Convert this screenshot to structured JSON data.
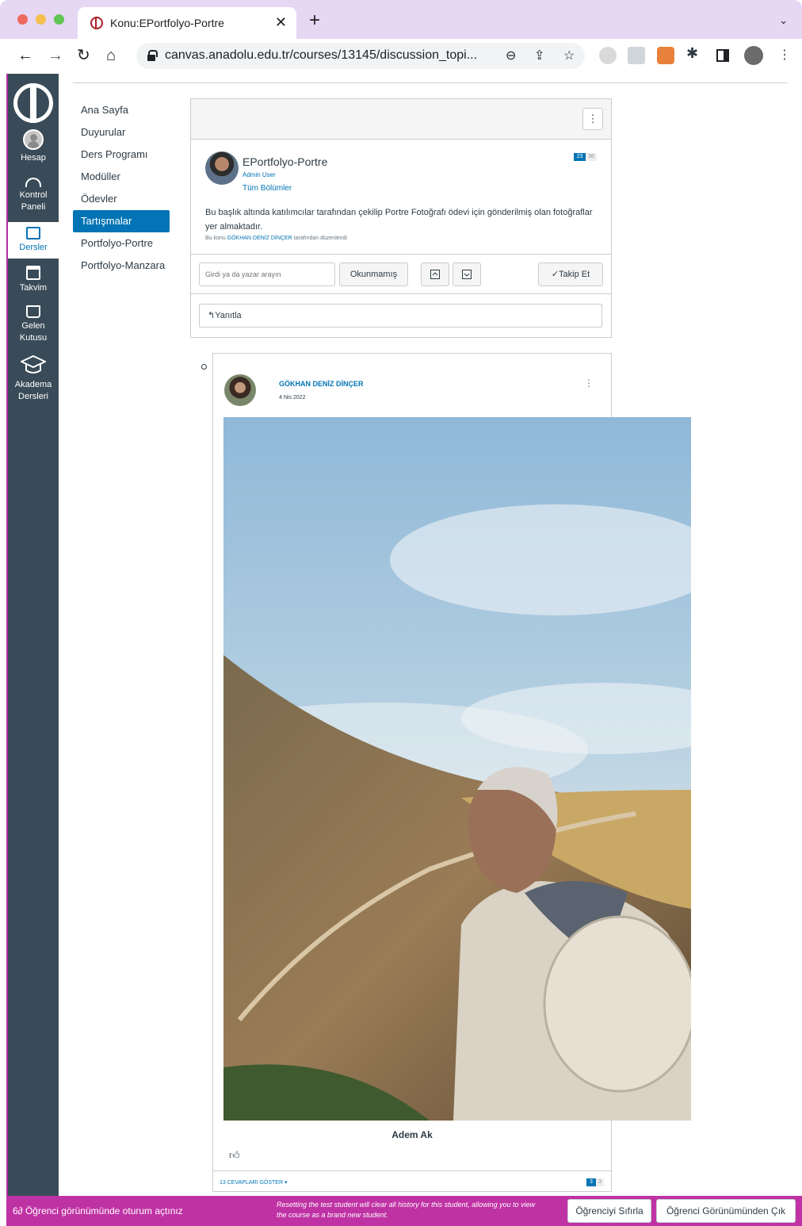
{
  "browser": {
    "tab_title": "Konu:EPortfolyo-Portre",
    "url": "canvas.anadolu.edu.tr/courses/13145/discussion_topi..."
  },
  "global_nav": {
    "items": [
      {
        "label": "Hesap",
        "icon": "account-avatar-icon"
      },
      {
        "label": "Kontrol\nPaneli",
        "icon": "dashboard-icon"
      },
      {
        "label": "Dersler",
        "icon": "courses-icon"
      },
      {
        "label": "Takvim",
        "icon": "calendar-icon"
      },
      {
        "label": "Gelen\nKutusu",
        "icon": "inbox-icon"
      },
      {
        "label": "Akadema\nDersleri",
        "icon": "graduation-cap-icon"
      }
    ]
  },
  "course_nav": {
    "items": [
      "Ana Sayfa",
      "Duyurular",
      "Ders Programı",
      "Modüller",
      "Ödevler",
      "Tartışmalar",
      "Portfolyo-Portre",
      "Portfolyo-Manzara"
    ],
    "active": "Tartışmalar"
  },
  "topic": {
    "title": "EPortfolyo-Portre",
    "role": "Admin User",
    "sections": "Tüm Bölümler",
    "unread_count": "23",
    "total_count": "36",
    "body": "Bu başlık altında katılımcılar tarafından çekilip Portre Fotoğrafı ödevi için gönderilmiş olan fotoğraflar yer almaktadır.",
    "edited_prefix": "Bu konu",
    "edited_by": "GÖKHAN DENİZ DİNÇER",
    "edited_suffix": "tarafından düzenlendi",
    "search_placeholder": "Girdi ya da yazar arayın",
    "unread_button": "Okunmamış",
    "follow_button": "Takip Et",
    "reply_label": "Yanıtla"
  },
  "entry": {
    "author": "GÖKHAN DENİZ DİNÇER",
    "date": "4 Nis 2022",
    "caption": "Adem Ak",
    "show_replies": "13 CEVAPLARI GÖSTER",
    "unread_count": "3",
    "total_count": "3"
  },
  "student_view": {
    "message": "Öğrenci görünümünde oturum açtınız",
    "note": "Resetting the test student will clear all history for this student, allowing you to view the course as a brand new student.",
    "reset_button": "Öğrenciyi Sıfırla",
    "exit_button": "Öğrenci Görünümünden Çık"
  },
  "colors": {
    "nav_bg": "#394b58",
    "accent": "#0374b5",
    "student_bar": "#bf32a4",
    "chrome_bg": "#e6d7f3"
  }
}
